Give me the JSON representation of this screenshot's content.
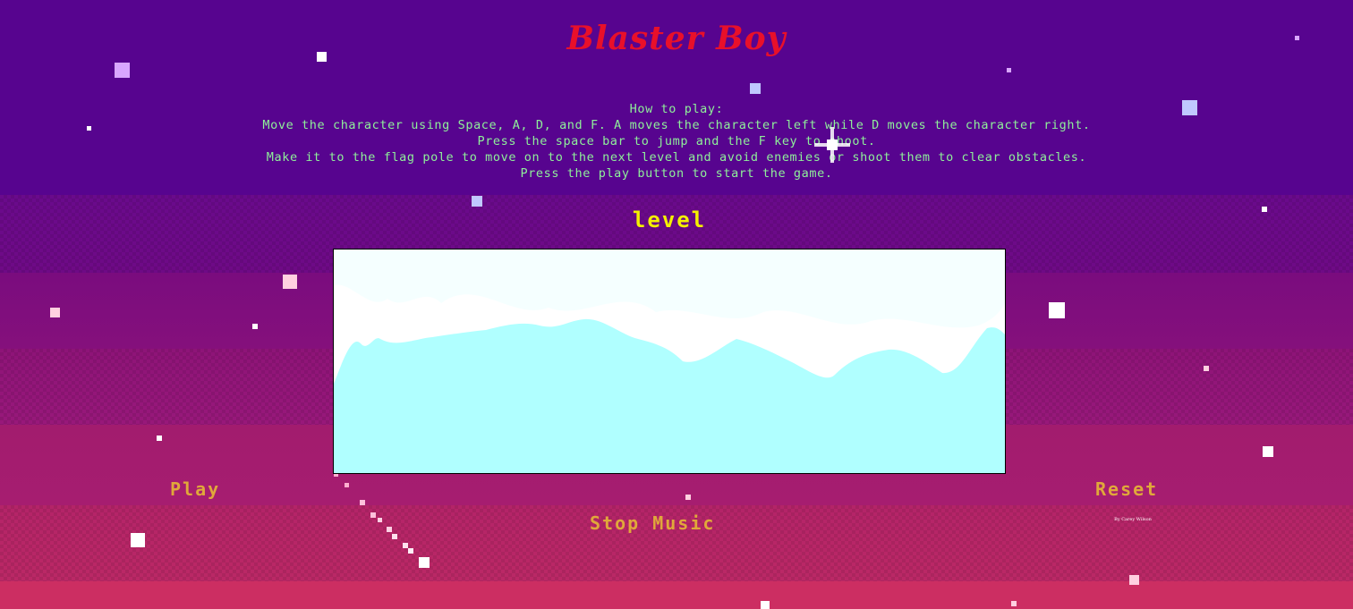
{
  "game": {
    "title": "Blaster Boy",
    "instructions": {
      "heading": "How to play:",
      "line1": "Move the character using Space, A, D, and F. A moves the character left while D moves the character right.",
      "line2": "Press the space bar to jump and the F key to shoot.",
      "line3": "Make it to the flag pole to move on to the next level and avoid enemies or shoot them to clear obstacles.",
      "line4": "Press the play button to start the game."
    },
    "level_label": "level"
  },
  "controls": {
    "play_label": "Play",
    "reset_label": "Reset",
    "music_label": "Stop Music"
  },
  "footer": {
    "credit": "By Carey Wilson"
  },
  "colors": {
    "title": "#e8102a",
    "instructions": "#8ff09a",
    "level": "#f4f000",
    "buttons": "#e0a83a",
    "sky_top": "#57048f",
    "ice": "#b0ffff"
  },
  "icons": {
    "sparkle": "sparkle-icon",
    "stars": "star-icon"
  }
}
